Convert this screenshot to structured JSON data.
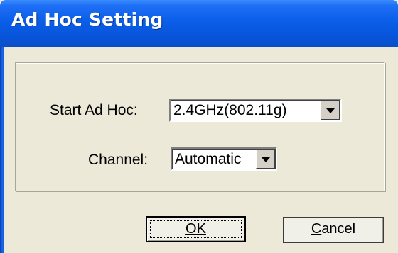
{
  "window": {
    "title": "Ad Hoc Setting"
  },
  "form": {
    "start_label": "Start Ad Hoc:",
    "start_value": "2.4GHz(802.11g)",
    "channel_label": "Channel:",
    "channel_value": "Automatic"
  },
  "buttons": {
    "ok": "OK",
    "cancel": "Cancel"
  },
  "colors": {
    "titlebar": "#0a5ee8",
    "dialog_bg": "#ece9d8"
  }
}
